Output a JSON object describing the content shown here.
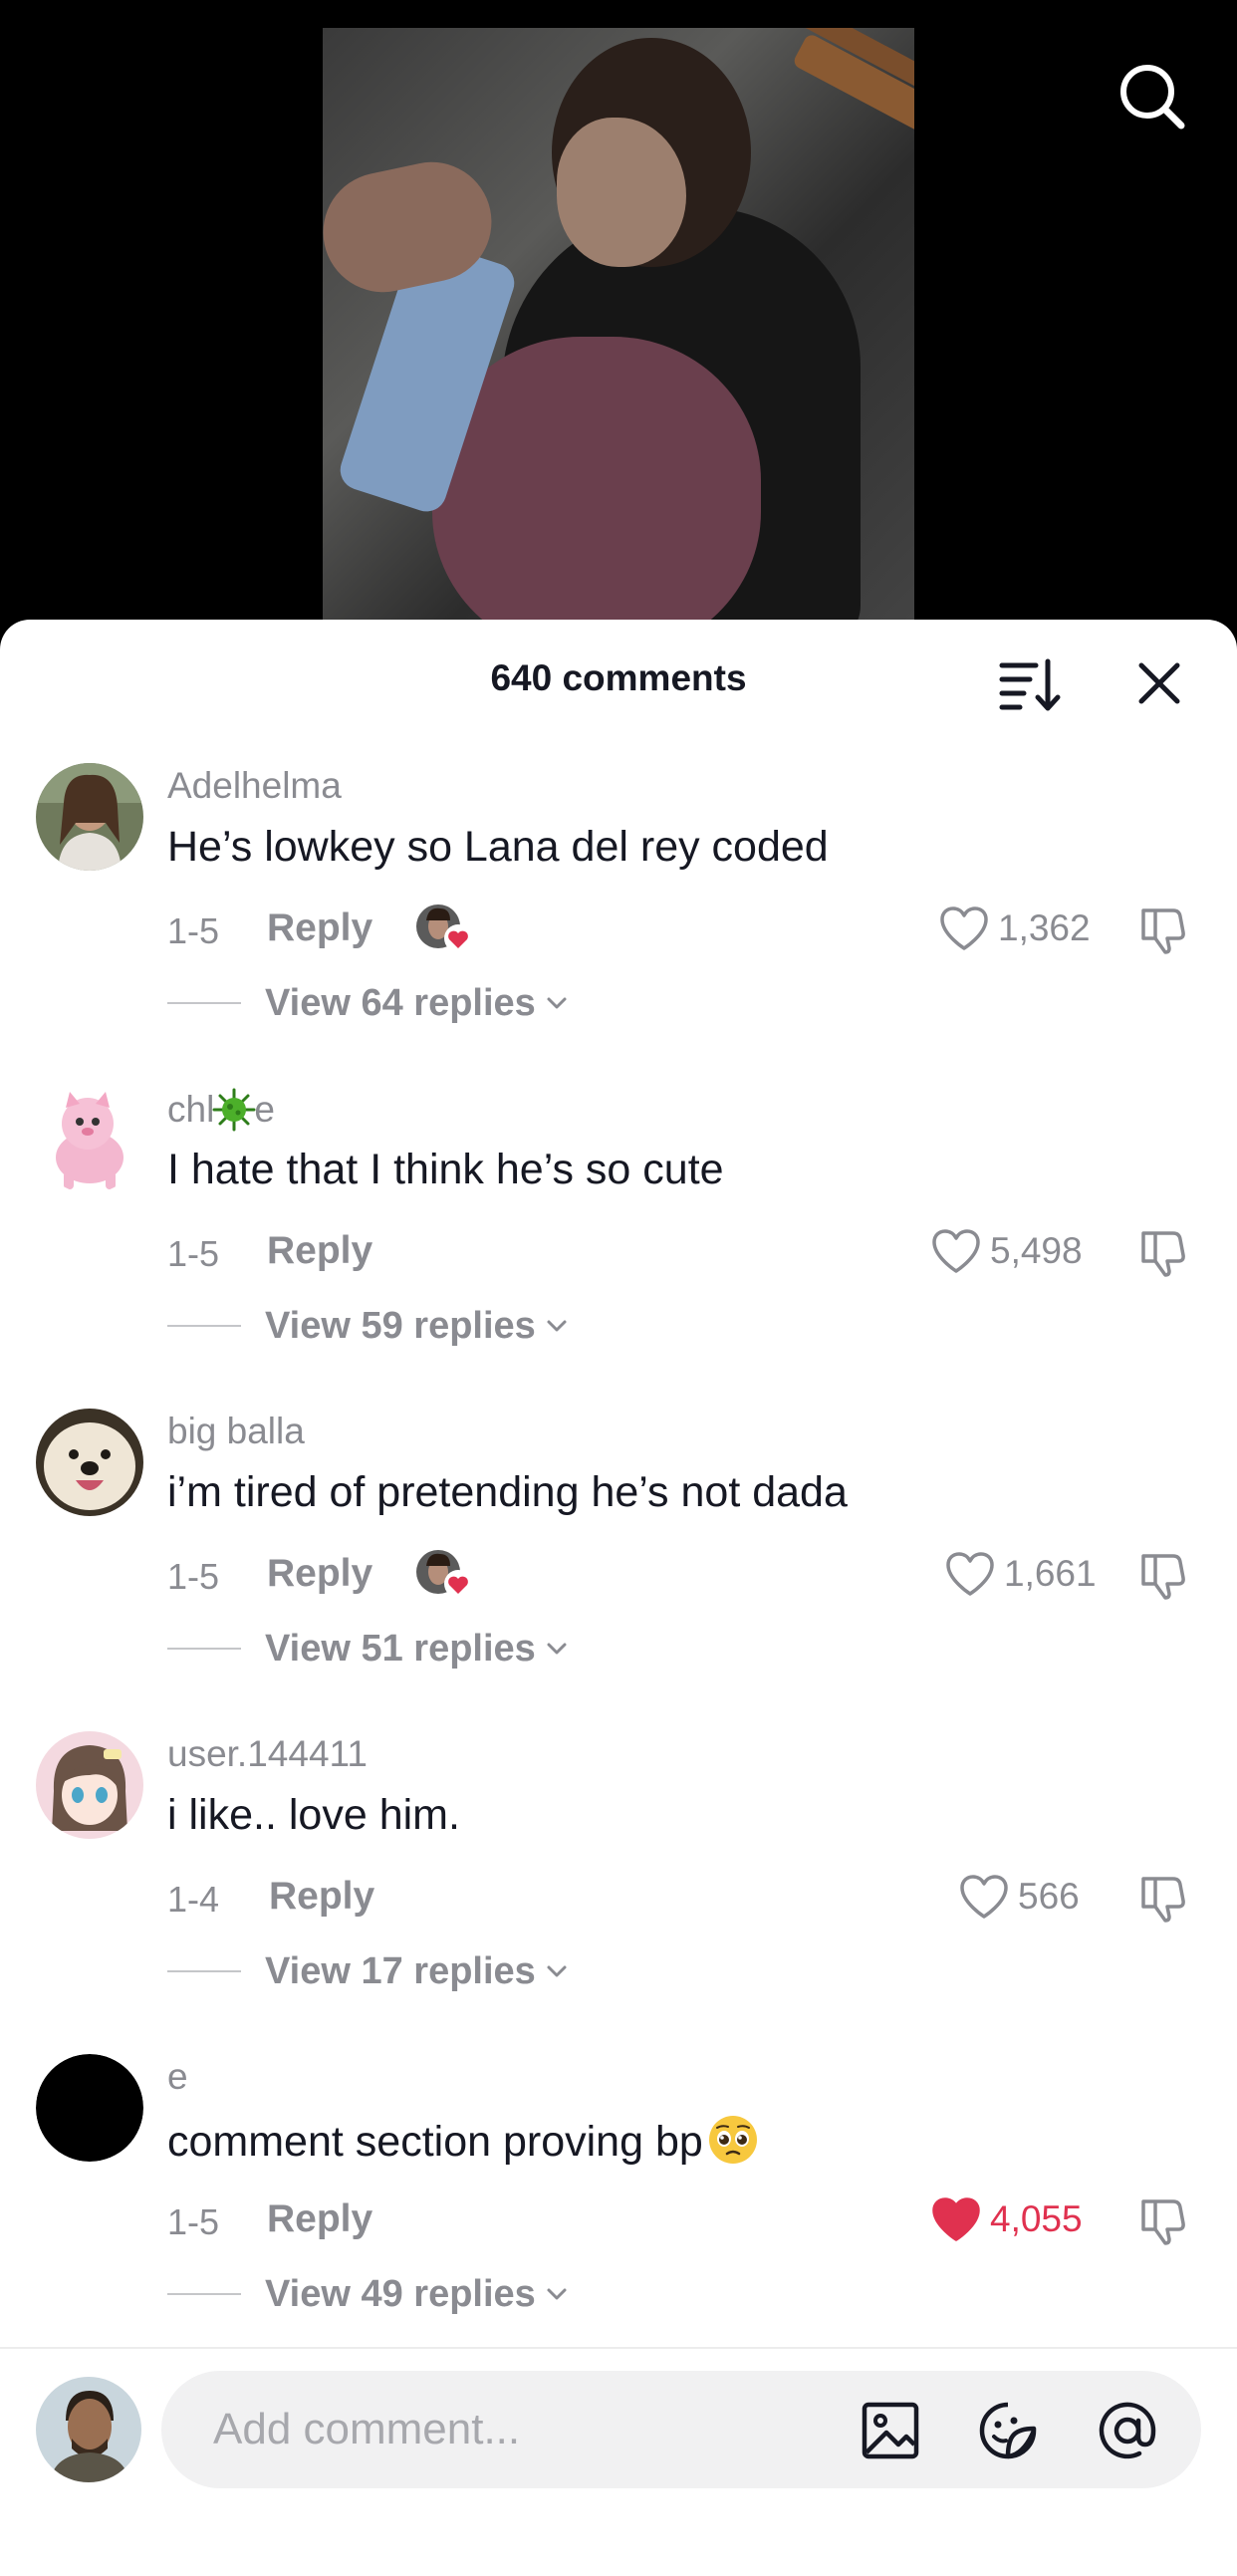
{
  "header": {
    "comments_count": "640 comments"
  },
  "comments": [
    {
      "username": "Adelhelma",
      "text": "He’s lowkey so Lana del rey coded",
      "date": "1-5",
      "reply_label": "Reply",
      "creator_liked": true,
      "likes": "1,362",
      "liked": false,
      "view_replies": "View 64 replies"
    },
    {
      "username_before": "chl",
      "username_after": "e",
      "text": "I hate that I think he’s so cute",
      "date": "1-5",
      "reply_label": "Reply",
      "creator_liked": false,
      "likes": "5,498",
      "liked": false,
      "view_replies": "View 59 replies"
    },
    {
      "username": "big balla",
      "text": "i’m tired of pretending he’s not dada",
      "date": "1-5",
      "reply_label": "Reply",
      "creator_liked": true,
      "likes": "1,661",
      "liked": false,
      "view_replies": "View 51 replies"
    },
    {
      "username": "user.144411",
      "text": "i like.. love him.",
      "date": "1-4",
      "reply_label": "Reply",
      "creator_liked": false,
      "likes": "566",
      "liked": false,
      "view_replies": "View 17 replies"
    },
    {
      "username": "e",
      "text": "comment section proving bp",
      "text_emoji": "pleading-face-icon",
      "date": "1-5",
      "reply_label": "Reply",
      "creator_liked": false,
      "likes": "4,055",
      "liked": true,
      "view_replies": "View 49 replies"
    }
  ],
  "composer": {
    "placeholder": "Add comment..."
  },
  "colors": {
    "liked": "#e0314f",
    "muted": "#8a8b91",
    "text": "#161823"
  }
}
